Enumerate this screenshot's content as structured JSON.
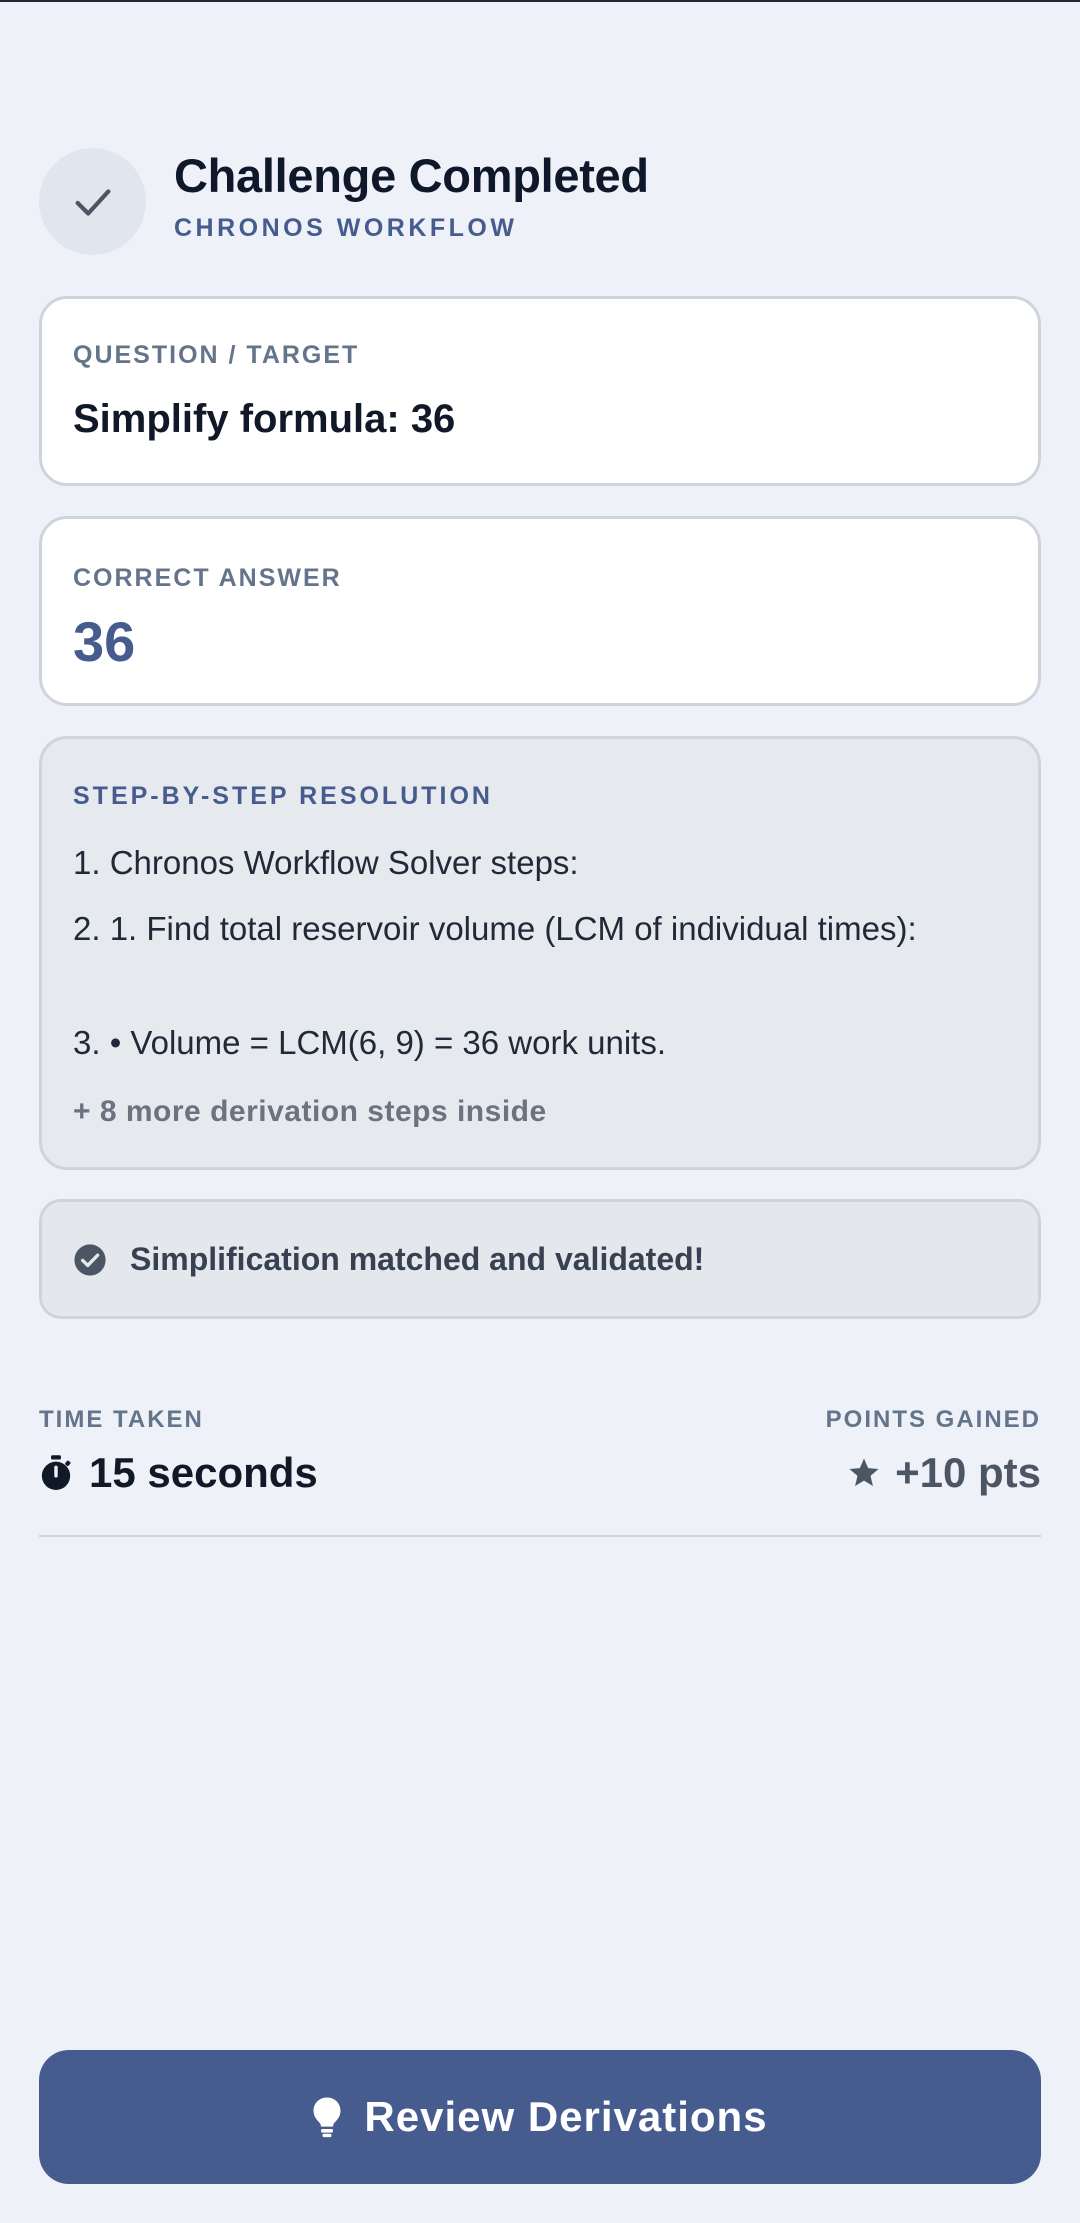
{
  "header": {
    "title": "Challenge Completed",
    "subtitle": "CHRONOS WORKFLOW",
    "icon": "check-icon"
  },
  "question": {
    "label": "QUESTION / TARGET",
    "value": "Simplify formula: 36"
  },
  "answer": {
    "label": "CORRECT ANSWER",
    "value": "36"
  },
  "resolution": {
    "label": "STEP-BY-STEP RESOLUTION",
    "steps": [
      "1. Chronos Workflow Solver steps:",
      "2. 1. Find total reservoir volume (LCM of individual times):",
      "3. • Volume = LCM(6, 9) = 36 work units."
    ],
    "more": "+ 8 more derivation steps inside"
  },
  "status": {
    "text": "Simplification matched and validated!",
    "icon": "check-circle-icon"
  },
  "stats": {
    "time_label": "TIME TAKEN",
    "time_value": "15 seconds",
    "time_icon": "stopwatch-icon",
    "points_label": "POINTS GAINED",
    "points_value": "+10 pts",
    "points_icon": "star-icon"
  },
  "cta": {
    "label": "Review Derivations",
    "icon": "lightbulb-icon"
  },
  "colors": {
    "accent": "#475c8e",
    "background": "#eef2f8",
    "card": "#ffffff",
    "muted": "#64748b"
  }
}
